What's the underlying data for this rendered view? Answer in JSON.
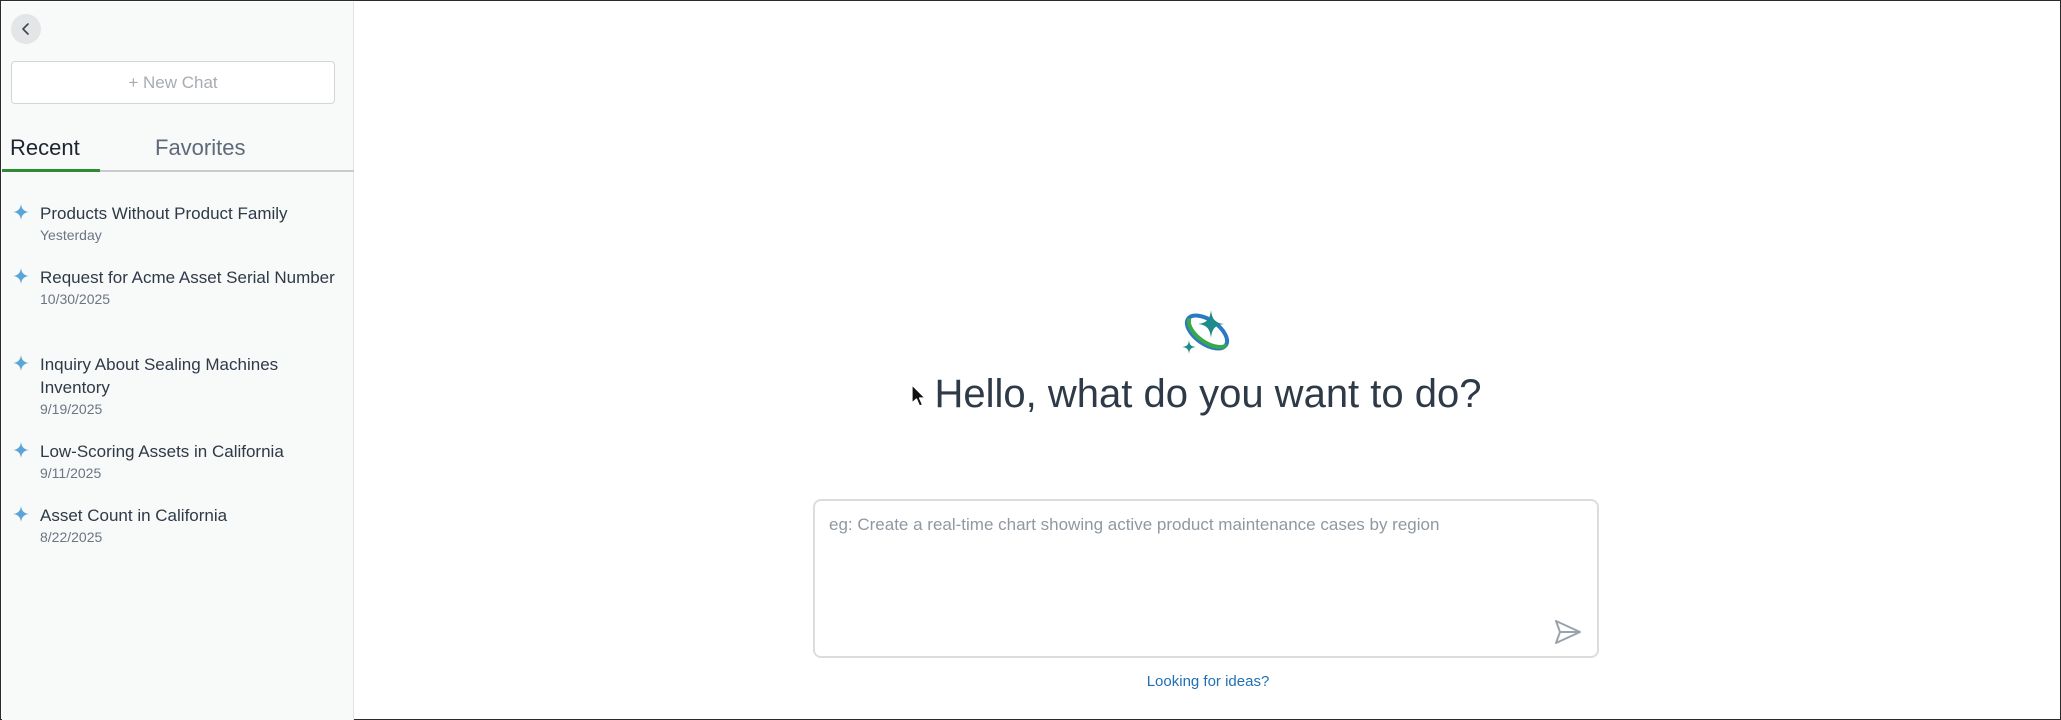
{
  "sidebar": {
    "new_chat_label": "+ New Chat",
    "tabs": [
      {
        "label": "Recent",
        "active": true
      },
      {
        "label": "Favorites",
        "active": false
      }
    ],
    "history": [
      {
        "title": "Products Without Product Family",
        "date": "Yesterday"
      },
      {
        "title": "Request for Acme Asset Serial Number",
        "date": "10/30/2025"
      },
      {
        "title": "Inquiry About Sealing Machines Inventory",
        "date": "9/19/2025"
      },
      {
        "title": "Low-Scoring Assets in California",
        "date": "9/11/2025"
      },
      {
        "title": "Asset Count in California",
        "date": "8/22/2025"
      }
    ],
    "item_icon": "sparkle-icon",
    "collapse_icon": "chevron-left-icon"
  },
  "main": {
    "logo_icon": "ai-sparkle-orbit-logo",
    "greeting": "Hello, what do you want to do?",
    "prompt": {
      "value": "",
      "placeholder": "eg: Create a real-time chart showing active product maintenance cases by region"
    },
    "send_icon": "send-icon",
    "ideas_link": "Looking for ideas?"
  },
  "colors": {
    "accent_green": "#2e8b34",
    "link_blue": "#1f6fb5",
    "sparkle_blue": "#5ba4d6",
    "logo_teal": "#1e8a8a",
    "logo_blue": "#2b79c2"
  }
}
